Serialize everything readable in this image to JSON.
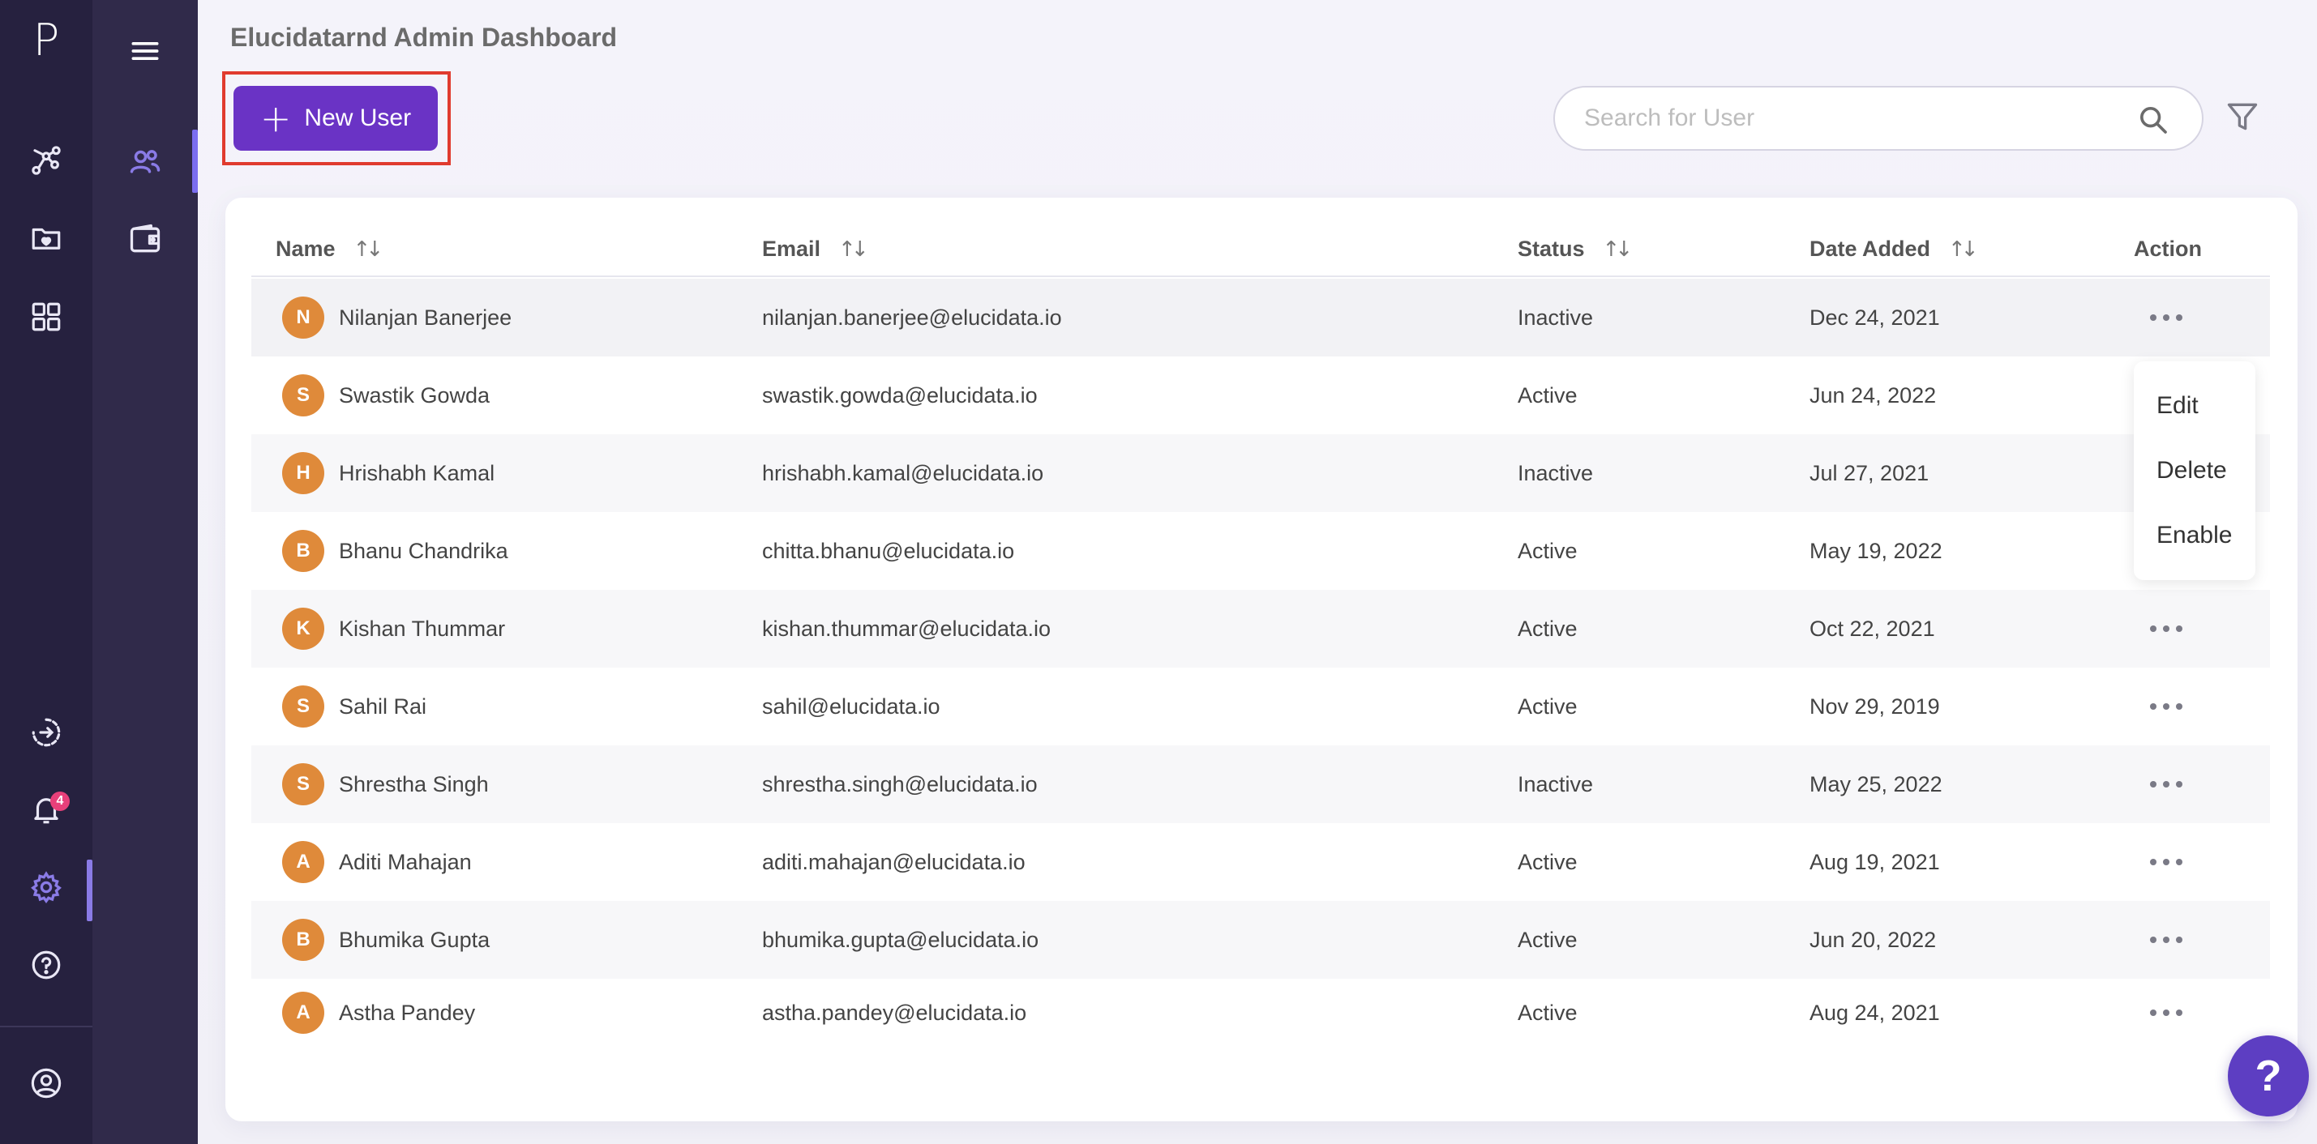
{
  "rail": {
    "logo": "P",
    "notifications_count": "4",
    "items": [
      {
        "icon": "workflow-icon"
      },
      {
        "icon": "favorites-folder-icon"
      },
      {
        "icon": "apps-grid-icon"
      },
      {
        "icon": "logout-icon"
      },
      {
        "icon": "bell-icon"
      },
      {
        "icon": "gear-icon"
      },
      {
        "icon": "help-circle-icon"
      },
      {
        "icon": "account-icon"
      }
    ]
  },
  "subnav": {
    "items": [
      {
        "icon": "users-icon"
      },
      {
        "icon": "wallet-icon"
      }
    ]
  },
  "header": {
    "title": "Elucidatarnd Admin Dashboard",
    "new_user_label": "New User",
    "search_placeholder": "Search for User"
  },
  "table": {
    "columns": [
      "Name",
      "Email",
      "Status",
      "Date Added",
      "Action"
    ],
    "rows": [
      {
        "initial": "N",
        "name": "Nilanjan Banerjee",
        "email": "nilanjan.banerjee@elucidata.io",
        "status": "Inactive",
        "date": "Dec 24, 2021"
      },
      {
        "initial": "S",
        "name": "Swastik Gowda",
        "email": "swastik.gowda@elucidata.io",
        "status": "Active",
        "date": "Jun 24, 2022"
      },
      {
        "initial": "H",
        "name": "Hrishabh Kamal",
        "email": "hrishabh.kamal@elucidata.io",
        "status": "Inactive",
        "date": "Jul 27, 2021"
      },
      {
        "initial": "B",
        "name": "Bhanu Chandrika",
        "email": "chitta.bhanu@elucidata.io",
        "status": "Active",
        "date": "May 19, 2022"
      },
      {
        "initial": "K",
        "name": "Kishan Thummar",
        "email": "kishan.thummar@elucidata.io",
        "status": "Active",
        "date": "Oct 22, 2021"
      },
      {
        "initial": "S",
        "name": "Sahil Rai",
        "email": "sahil@elucidata.io",
        "status": "Active",
        "date": "Nov 29, 2019"
      },
      {
        "initial": "S",
        "name": "Shrestha Singh",
        "email": "shrestha.singh@elucidata.io",
        "status": "Inactive",
        "date": "May 25, 2022"
      },
      {
        "initial": "A",
        "name": "Aditi Mahajan",
        "email": "aditi.mahajan@elucidata.io",
        "status": "Active",
        "date": "Aug 19, 2021"
      },
      {
        "initial": "B",
        "name": "Bhumika Gupta",
        "email": "bhumika.gupta@elucidata.io",
        "status": "Active",
        "date": "Jun 20, 2022"
      },
      {
        "initial": "A",
        "name": "Astha Pandey",
        "email": "astha.pandey@elucidata.io",
        "status": "Active",
        "date": "Aug 24, 2021"
      }
    ]
  },
  "action_menu": {
    "items": [
      "Edit",
      "Delete",
      "Enable"
    ]
  },
  "help_fab": "?",
  "colors": {
    "rail_bg": "#26213f",
    "subnav_bg": "#302a4a",
    "primary": "#6a33c5",
    "accent": "#8a7be6",
    "avatar": "#df8a3a",
    "highlight_border": "#e03b2e"
  }
}
